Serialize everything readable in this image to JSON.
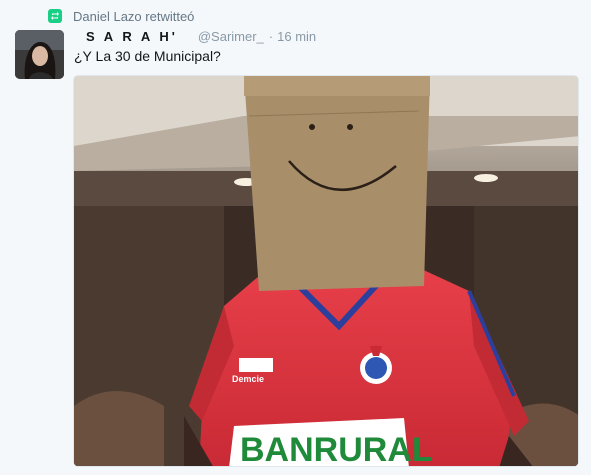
{
  "retweet": {
    "icon": "retweet-icon",
    "icon_color": "#19cf86",
    "text": "Daniel Lazo retwitteó"
  },
  "tweet": {
    "display_name": "S A R A H'",
    "screen_name": "@Sarimer_",
    "separator": "·",
    "time": "16 min",
    "text": "¿Y La 30 de Municipal?",
    "media": {
      "jersey_brand": "Demcie",
      "jersey_sponsor": "BANRURAL"
    }
  }
}
